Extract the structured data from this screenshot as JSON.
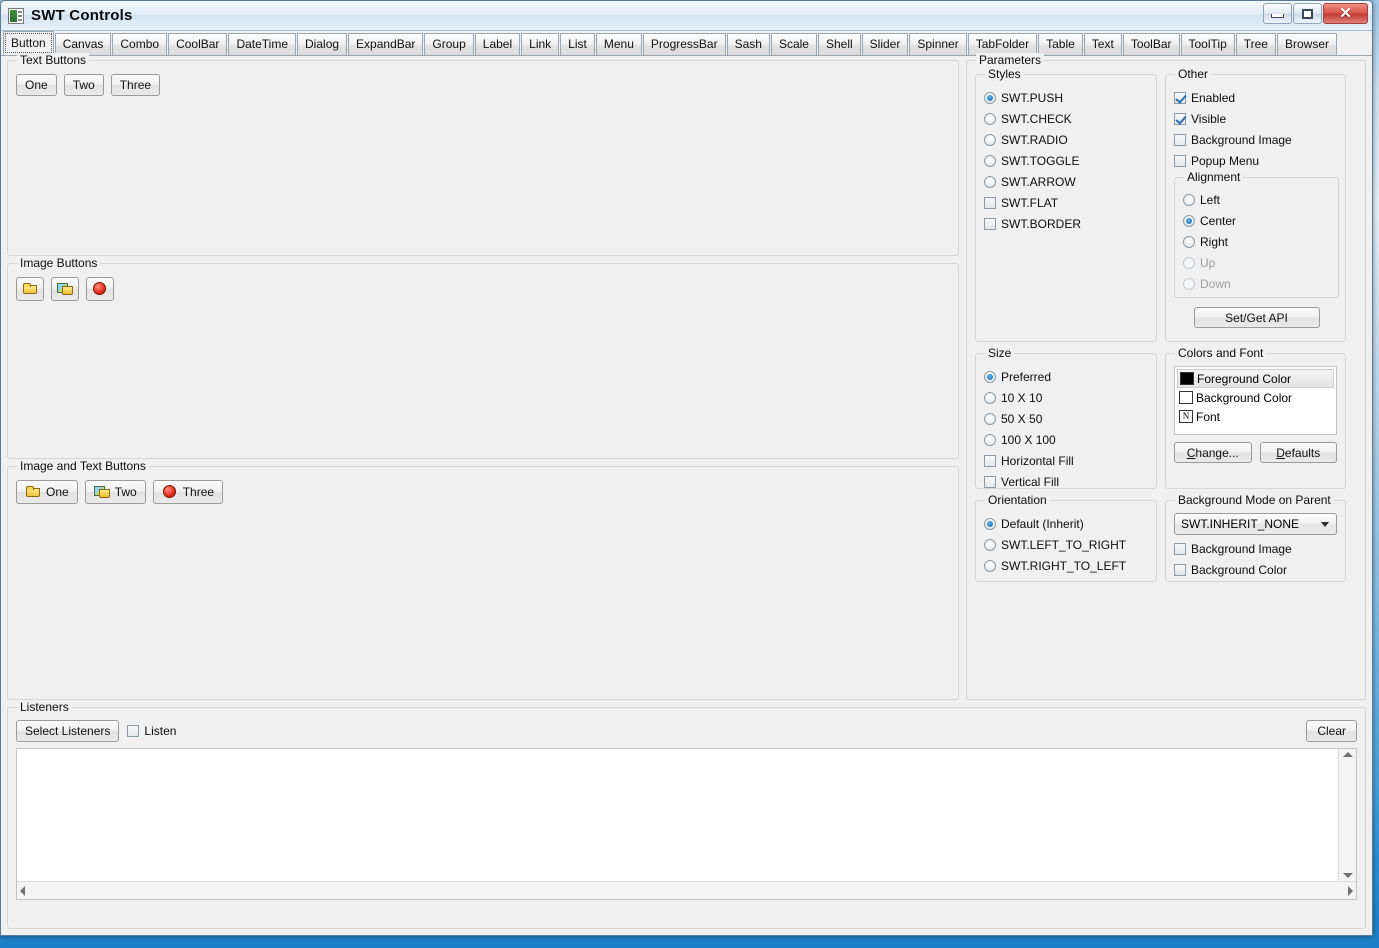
{
  "window": {
    "title": "SWT Controls",
    "icon": "swt-app-icon",
    "buttons": {
      "minimize": "minimize-button",
      "maximize": "maximize-button",
      "close": "close-button"
    }
  },
  "tabs": [
    {
      "label": "Button",
      "selected": true
    },
    {
      "label": "Canvas",
      "selected": false
    },
    {
      "label": "Combo",
      "selected": false
    },
    {
      "label": "CoolBar",
      "selected": false
    },
    {
      "label": "DateTime",
      "selected": false
    },
    {
      "label": "Dialog",
      "selected": false
    },
    {
      "label": "ExpandBar",
      "selected": false
    },
    {
      "label": "Group",
      "selected": false
    },
    {
      "label": "Label",
      "selected": false
    },
    {
      "label": "Link",
      "selected": false
    },
    {
      "label": "List",
      "selected": false
    },
    {
      "label": "Menu",
      "selected": false
    },
    {
      "label": "ProgressBar",
      "selected": false
    },
    {
      "label": "Sash",
      "selected": false
    },
    {
      "label": "Scale",
      "selected": false
    },
    {
      "label": "Shell",
      "selected": false
    },
    {
      "label": "Slider",
      "selected": false
    },
    {
      "label": "Spinner",
      "selected": false
    },
    {
      "label": "TabFolder",
      "selected": false
    },
    {
      "label": "Table",
      "selected": false
    },
    {
      "label": "Text",
      "selected": false
    },
    {
      "label": "ToolBar",
      "selected": false
    },
    {
      "label": "ToolTip",
      "selected": false
    },
    {
      "label": "Tree",
      "selected": false
    },
    {
      "label": "Browser",
      "selected": false
    }
  ],
  "text_buttons": {
    "title": "Text Buttons",
    "buttons": [
      "One",
      "Two",
      "Three"
    ]
  },
  "image_buttons": {
    "title": "Image Buttons",
    "buttons": [
      {
        "icon": "folder-closed-icon"
      },
      {
        "icon": "folder-open-image-icon"
      },
      {
        "icon": "red-circle-icon"
      }
    ]
  },
  "image_and_text_buttons": {
    "title": "Image and Text Buttons",
    "buttons": [
      {
        "icon": "folder-closed-icon",
        "label": "One"
      },
      {
        "icon": "folder-open-image-icon",
        "label": "Two"
      },
      {
        "icon": "red-circle-icon",
        "label": "Three"
      }
    ]
  },
  "parameters": {
    "title": "Parameters",
    "styles": {
      "title": "Styles",
      "radios": [
        {
          "label": "SWT.PUSH",
          "checked": true
        },
        {
          "label": "SWT.CHECK",
          "checked": false
        },
        {
          "label": "SWT.RADIO",
          "checked": false
        },
        {
          "label": "SWT.TOGGLE",
          "checked": false
        },
        {
          "label": "SWT.ARROW",
          "checked": false
        }
      ],
      "checks": [
        {
          "label": "SWT.FLAT",
          "checked": false
        },
        {
          "label": "SWT.BORDER",
          "checked": false
        }
      ]
    },
    "other": {
      "title": "Other",
      "checks": [
        {
          "label": "Enabled",
          "checked": true
        },
        {
          "label": "Visible",
          "checked": true
        },
        {
          "label": "Background Image",
          "checked": false
        },
        {
          "label": "Popup Menu",
          "checked": false
        }
      ],
      "alignment": {
        "title": "Alignment",
        "radios": [
          {
            "label": "Left",
            "checked": false,
            "disabled": false
          },
          {
            "label": "Center",
            "checked": true,
            "disabled": false
          },
          {
            "label": "Right",
            "checked": false,
            "disabled": false
          },
          {
            "label": "Up",
            "checked": false,
            "disabled": true
          },
          {
            "label": "Down",
            "checked": false,
            "disabled": true
          }
        ]
      },
      "set_get_api": "Set/Get API"
    },
    "size": {
      "title": "Size",
      "radios": [
        {
          "label": "Preferred",
          "checked": true
        },
        {
          "label": "10 X 10",
          "checked": false
        },
        {
          "label": "50 X 50",
          "checked": false
        },
        {
          "label": "100 X 100",
          "checked": false
        }
      ],
      "checks": [
        {
          "label": "Horizontal Fill",
          "checked": false
        },
        {
          "label": "Vertical Fill",
          "checked": false
        }
      ]
    },
    "orientation": {
      "title": "Orientation",
      "radios": [
        {
          "label": "Default (Inherit)",
          "checked": true
        },
        {
          "label": "SWT.LEFT_TO_RIGHT",
          "checked": false
        },
        {
          "label": "SWT.RIGHT_TO_LEFT",
          "checked": false
        }
      ]
    },
    "colors_and_font": {
      "title": "Colors and Font",
      "items": [
        {
          "label": "Foreground Color",
          "swatch": "black",
          "selected": true
        },
        {
          "label": "Background Color",
          "swatch": "white",
          "selected": false
        },
        {
          "label": "Font",
          "swatch": "font",
          "glyph": "N",
          "selected": false
        }
      ],
      "change_button": "Change...",
      "change_mnemonic": "C",
      "defaults_button": "Defaults",
      "defaults_mnemonic": "D"
    },
    "background_mode": {
      "title": "Background Mode on Parent",
      "combo_value": "SWT.INHERIT_NONE",
      "checks": [
        {
          "label": "Background Image",
          "checked": false
        },
        {
          "label": "Background Color",
          "checked": false
        }
      ]
    }
  },
  "listeners": {
    "title": "Listeners",
    "select_button": "Select Listeners",
    "listen_checkbox": {
      "label": "Listen",
      "checked": false
    },
    "clear_button": "Clear",
    "log_text": ""
  }
}
